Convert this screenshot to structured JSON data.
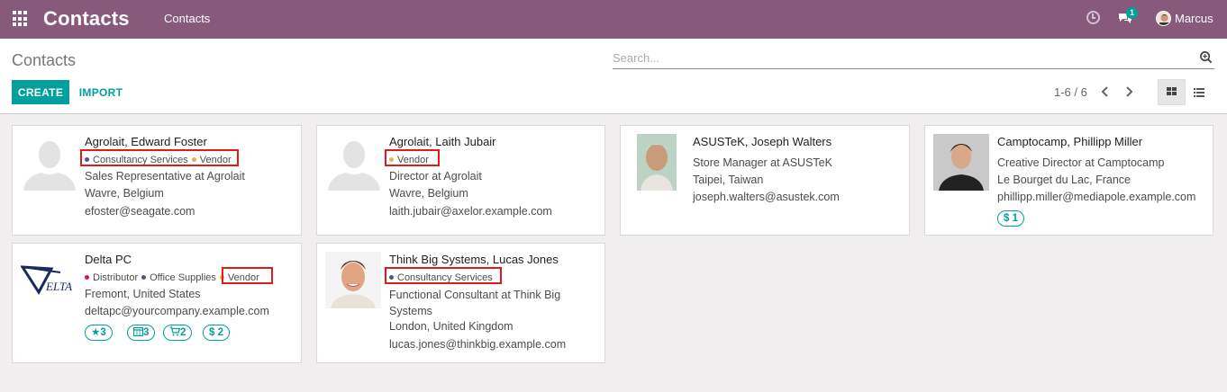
{
  "navbar": {
    "brand": "Contacts",
    "menu_item": "Contacts",
    "messages_count": "1",
    "user_name": "Marcus"
  },
  "control_panel": {
    "title": "Contacts",
    "search_placeholder": "Search...",
    "create_label": "CREATE",
    "import_label": "IMPORT",
    "pager_text": "1-6 / 6"
  },
  "tag_colors": {
    "consultancy": "#4c5a7a",
    "vendor": "#f0ad4e",
    "distributor": "#d6145f",
    "office": "#4c5a7a"
  },
  "cards": [
    {
      "name": "Agrolait, Edward Foster",
      "tags": [
        "Consultancy Services",
        "Vendor"
      ],
      "function": "Sales Representative at Agrolait",
      "location": "Wavre, Belgium",
      "email": "efoster@seagate.com"
    },
    {
      "name": "Agrolait, Laith Jubair",
      "tags": [
        "Vendor"
      ],
      "function": "Director at Agrolait",
      "location": "Wavre, Belgium",
      "email": "laith.jubair@axelor.example.com"
    },
    {
      "name": "ASUSTeK, Joseph Walters",
      "function": "Store Manager at ASUSTeK",
      "location": "Taipei, Taiwan",
      "email": "joseph.walters@asustek.com"
    },
    {
      "name": "Camptocamp, Phillipp Miller",
      "function": "Creative Director at Camptocamp",
      "location": "Le Bourget du Lac, France",
      "email": "phillipp.miller@mediapole.example.com",
      "badges": [
        {
          "icon": "dollar-icon",
          "value": "1"
        }
      ]
    },
    {
      "name": "Delta PC",
      "logo_text": "ELTA",
      "tags": [
        "Distributor",
        "Office Supplies",
        "Vendor"
      ],
      "location": "Fremont, United States",
      "email": "deltapc@yourcompany.example.com",
      "badges": [
        {
          "icon": "star-icon",
          "value": "3"
        },
        {
          "icon": "calendar-icon",
          "value": "3"
        },
        {
          "icon": "cart-icon",
          "value": "2"
        },
        {
          "icon": "dollar-icon",
          "value": "2"
        }
      ]
    },
    {
      "name": "Think Big Systems, Lucas Jones",
      "tags": [
        "Consultancy Services"
      ],
      "function": "Functional Consultant at Think Big Systems",
      "location": "London, United Kingdom",
      "email": "lucas.jones@thinkbig.example.com"
    }
  ]
}
